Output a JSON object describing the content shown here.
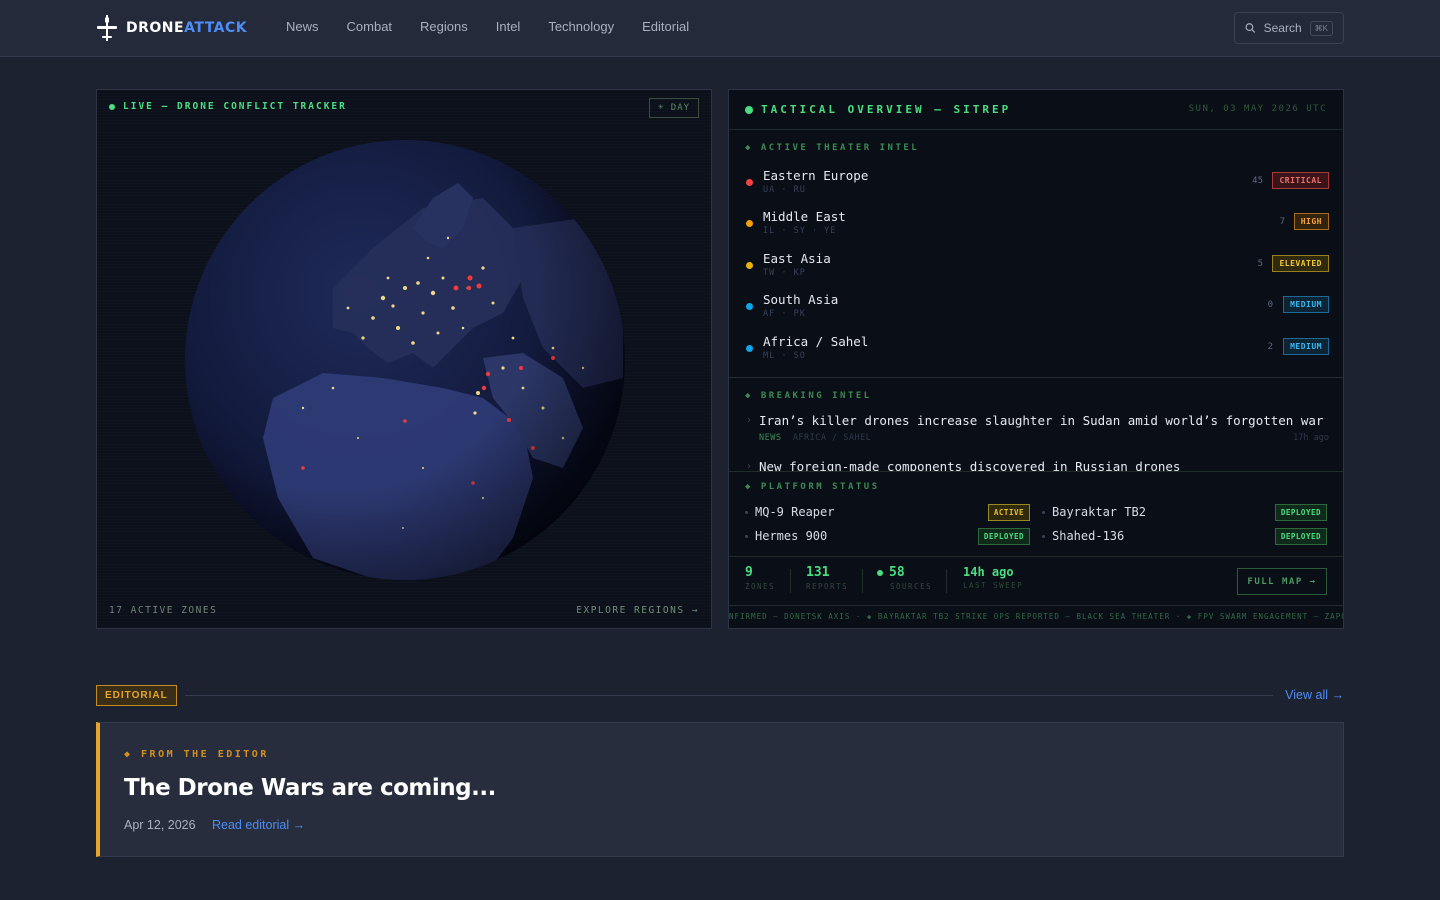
{
  "header": {
    "logo_a": "DRONE",
    "logo_b": "ATTACK",
    "nav": [
      "News",
      "Combat",
      "Regions",
      "Intel",
      "Technology",
      "Editorial"
    ],
    "search_label": "Search",
    "search_kbd": "⌘K"
  },
  "tracker": {
    "live_label": "LIVE — DRONE CONFLICT TRACKER",
    "day_label": "☀ DAY",
    "zones_label": "17 ACTIVE ZONES",
    "explore_label": "EXPLORE REGIONS →"
  },
  "sitrep": {
    "title": "TACTICAL OVERVIEW — SITREP",
    "date": "SUN, 03 MAY 2026 UTC",
    "theater_label": "◆ ACTIVE THEATER INTEL",
    "theaters": [
      {
        "name": "Eastern Europe",
        "sub": "UA · RU",
        "count": "45",
        "badge": "CRITICAL",
        "color": "#ef4444"
      },
      {
        "name": "Middle East",
        "sub": "IL · SY · YE",
        "count": "7",
        "badge": "HIGH",
        "color": "#f59e0b"
      },
      {
        "name": "East Asia",
        "sub": "TW · KP",
        "count": "5",
        "badge": "ELEVATED",
        "color": "#eab308"
      },
      {
        "name": "South Asia",
        "sub": "AF · PK",
        "count": "0",
        "badge": "MEDIUM",
        "color": "#0ea5e9"
      },
      {
        "name": "Africa / Sahel",
        "sub": "ML · SO",
        "count": "2",
        "badge": "MEDIUM",
        "color": "#0ea5e9"
      }
    ],
    "breaking_label": "◆ BREAKING INTEL",
    "breaking": [
      {
        "title": "Iran’s killer drones increase slaughter in Sudan amid world’s forgotten war",
        "tag": "NEWS",
        "region": "AFRICA / SAHEL",
        "time": "17h ago"
      },
      {
        "title": "New foreign-made components discovered in Russian drones",
        "tag": "",
        "region": "",
        "time": ""
      }
    ],
    "platform_label": "◆ PLATFORM STATUS",
    "platforms": [
      {
        "name": "MQ-9 Reaper",
        "status": "ACTIVE"
      },
      {
        "name": "Bayraktar TB2",
        "status": "DEPLOYED"
      },
      {
        "name": "Hermes 900",
        "status": "DEPLOYED"
      },
      {
        "name": "Shahed-136",
        "status": "DEPLOYED"
      }
    ],
    "stats": [
      {
        "value": "9",
        "label": "ZONES"
      },
      {
        "value": "131",
        "label": "REPORTS"
      },
      {
        "value": "58",
        "label": "SOURCES"
      },
      {
        "value": "14h ago",
        "label": "LAST SWEEP"
      }
    ],
    "full_map": "FULL MAP →",
    "ticker": "NFIRMED — DONETSK AXIS · ◆ BAYRAKTAR TB2 STRIKE OPS REPORTED — BLACK SEA THEATER · ◆ FPV SWARM ENGAGEMENT — ZAPORIZHZHIA FRONT"
  },
  "editorial": {
    "tag": "EDITORIAL",
    "view_all": "View all →",
    "kicker": "◆ FROM THE EDITOR",
    "title": "The Drone Wars are coming...",
    "date": "Apr 12, 2026",
    "read": "Read editorial →"
  },
  "colors": {
    "accent_green": "#4ade80",
    "accent_blue": "#4f8df5",
    "accent_amber": "#e5a52a",
    "critical": "#ef4444"
  }
}
